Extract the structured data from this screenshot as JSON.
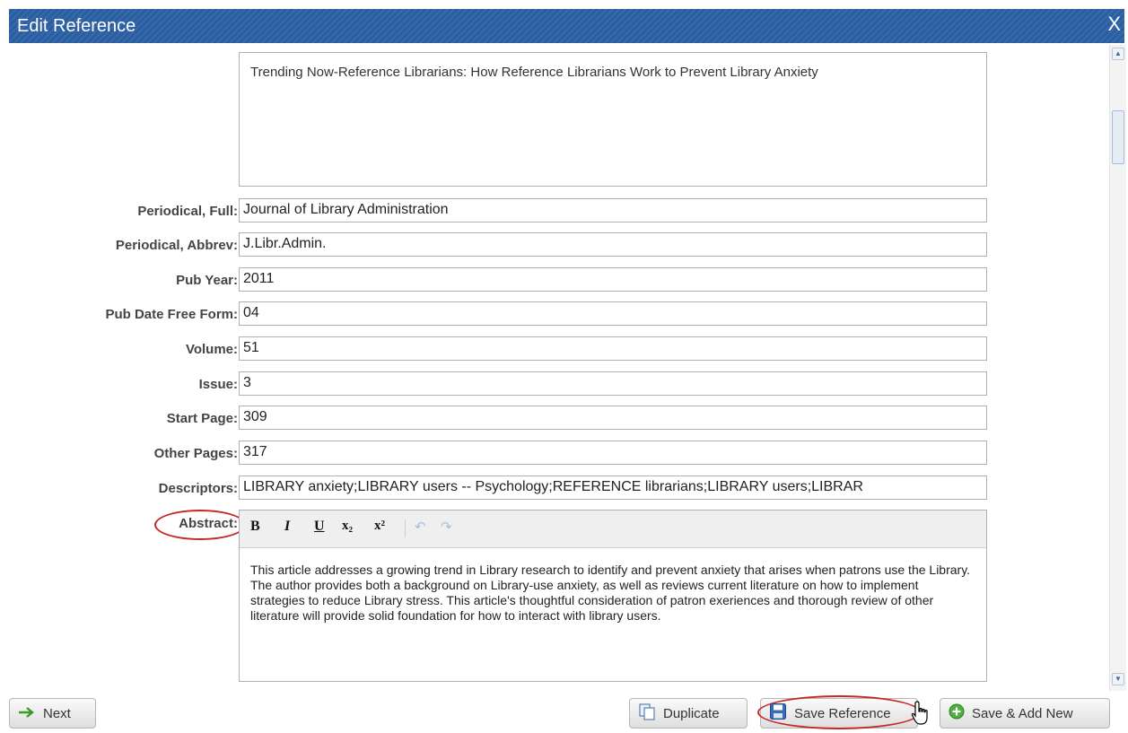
{
  "window": {
    "title": "Edit Reference",
    "close_label": "X"
  },
  "reference": {
    "title_text": "Trending Now-Reference Librarians: How Reference Librarians Work to Prevent Library Anxiety",
    "fields": [
      {
        "label": "Periodical, Full:",
        "value": "Journal of Library Administration"
      },
      {
        "label": "Periodical, Abbrev:",
        "value": "J.Libr.Admin."
      },
      {
        "label": "Pub Year:",
        "value": "2011"
      },
      {
        "label": "Pub Date Free Form:",
        "value": "04"
      },
      {
        "label": "Volume:",
        "value": "51"
      },
      {
        "label": "Issue:",
        "value": "3"
      },
      {
        "label": "Start Page:",
        "value": "309"
      },
      {
        "label": "Other Pages:",
        "value": "317"
      },
      {
        "label": "Descriptors:",
        "value": "LIBRARY anxiety;LIBRARY users -- Psychology;REFERENCE librarians;LIBRARY users;LIBRAR"
      }
    ],
    "abstract": {
      "label": "Abstract:",
      "toolbar": {
        "bold": "B",
        "italic": "I",
        "underline": "U",
        "subscript": "x₂",
        "superscript": "x²"
      },
      "text": "This article addresses a growing trend in Library research to identify and prevent anxiety that arises when patrons use the Library. The author provides both a background on Library-use anxiety, as well as reviews current literature on how to implement strategies to reduce Library stress. This article's thoughtful consideration of patron exeriences and thorough review of other literature will provide solid foundation for how to interact with library users."
    }
  },
  "footer": {
    "next_label": "Next",
    "duplicate_label": "Duplicate",
    "save_label": "Save Reference",
    "save_add_label": "Save & Add New"
  },
  "colors": {
    "titlebar": "#2a5ea3",
    "highlight": "#c62828"
  },
  "icons": {
    "next": "arrow-right-icon",
    "duplicate": "copy-icon",
    "save": "floppy-disk-icon",
    "save_add": "plus-circle-icon"
  }
}
